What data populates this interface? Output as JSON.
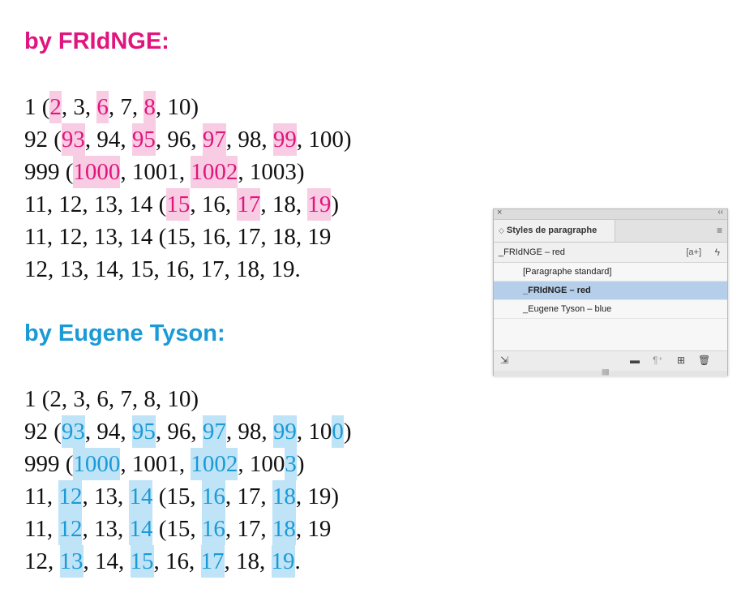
{
  "fringe_heading": "by FRIdNGE:",
  "tyson_heading": "by Eugene Tyson:",
  "colors": {
    "red": "#e0157d",
    "red_highlight": "#f8cde3",
    "blue": "#1a9ad6",
    "blue_highlight": "#bfe3f7"
  },
  "fringe_lines": [
    [
      [
        "1 ("
      ],
      [
        "2",
        "h"
      ],
      [
        ", 3, "
      ],
      [
        "6",
        "h"
      ],
      [
        ", 7, "
      ],
      [
        "8",
        "h"
      ],
      [
        ", 10)"
      ]
    ],
    [
      [
        "92 ("
      ],
      [
        "93",
        "h"
      ],
      [
        ", 94, "
      ],
      [
        "95",
        "h"
      ],
      [
        ", 96, "
      ],
      [
        "97",
        "h"
      ],
      [
        ", 98, "
      ],
      [
        "99",
        "h"
      ],
      [
        ", 100)"
      ]
    ],
    [
      [
        "999 ("
      ],
      [
        "1000",
        "h"
      ],
      [
        ", 1001, "
      ],
      [
        "1002",
        "h"
      ],
      [
        ", 1003)"
      ]
    ],
    [
      [
        "11, 12, 13, 14 ("
      ],
      [
        "15",
        "h"
      ],
      [
        ", 16, "
      ],
      [
        "17",
        "h"
      ],
      [
        ", 18, "
      ],
      [
        "19",
        "h"
      ],
      [
        ")"
      ]
    ],
    [
      [
        "11, 12, 13, 14 (15, 16, 17, 18, 19"
      ]
    ],
    [
      [
        "12, 13, 14, 15, 16, 17, 18, 19."
      ]
    ]
  ],
  "tyson_lines": [
    [
      [
        "1 (2, 3, 6, 7, 8, 10)"
      ]
    ],
    [
      [
        "92 ("
      ],
      [
        "93",
        "h"
      ],
      [
        ", 94, "
      ],
      [
        "95",
        "h"
      ],
      [
        ", 96, "
      ],
      [
        "97",
        "h"
      ],
      [
        ", 98, "
      ],
      [
        "99",
        "h"
      ],
      [
        ", 10"
      ],
      [
        "0",
        "h"
      ],
      [
        ")"
      ]
    ],
    [
      [
        "999 ("
      ],
      [
        "1000",
        "h"
      ],
      [
        ", 1001, "
      ],
      [
        "1002",
        "h"
      ],
      [
        ", 100"
      ],
      [
        "3",
        "h"
      ],
      [
        ")"
      ]
    ],
    [
      [
        "11, "
      ],
      [
        "12",
        "h"
      ],
      [
        ", 13, "
      ],
      [
        "14",
        "h"
      ],
      [
        " (15, "
      ],
      [
        "16",
        "h"
      ],
      [
        ", 17, "
      ],
      [
        "18",
        "h"
      ],
      [
        ", 19)"
      ]
    ],
    [
      [
        "11, "
      ],
      [
        "12",
        "h"
      ],
      [
        ", 13, "
      ],
      [
        "14",
        "h"
      ],
      [
        " (15, "
      ],
      [
        "16",
        "h"
      ],
      [
        ", 17, "
      ],
      [
        "18",
        "h"
      ],
      [
        ", 19"
      ]
    ],
    [
      [
        "12, "
      ],
      [
        "13",
        "h"
      ],
      [
        ", 14, "
      ],
      [
        "15",
        "h"
      ],
      [
        ", 16, "
      ],
      [
        "17",
        "h"
      ],
      [
        ", 18, "
      ],
      [
        "19",
        "h"
      ],
      [
        "."
      ]
    ]
  ],
  "panel": {
    "close_glyph": "×",
    "collapse_glyph": "‹‹",
    "tab_arrows": "◇",
    "tab_label": "Styles de paragraphe",
    "menu_glyph": "≡",
    "current_style": "_FRIdNGE – red",
    "aplus_label": "[a+]",
    "bolt_glyph": "ϟ",
    "items": [
      "[Paragraphe standard]",
      "_FRIdNGE – red",
      "_Eugene Tyson – blue"
    ],
    "selected_index": 1,
    "bottom_icons": {
      "load": "⇲",
      "folder": "▬",
      "clear": "¶⁺",
      "new": "⊞",
      "trash": "🗑"
    },
    "grip_glyph": "||||||||"
  }
}
